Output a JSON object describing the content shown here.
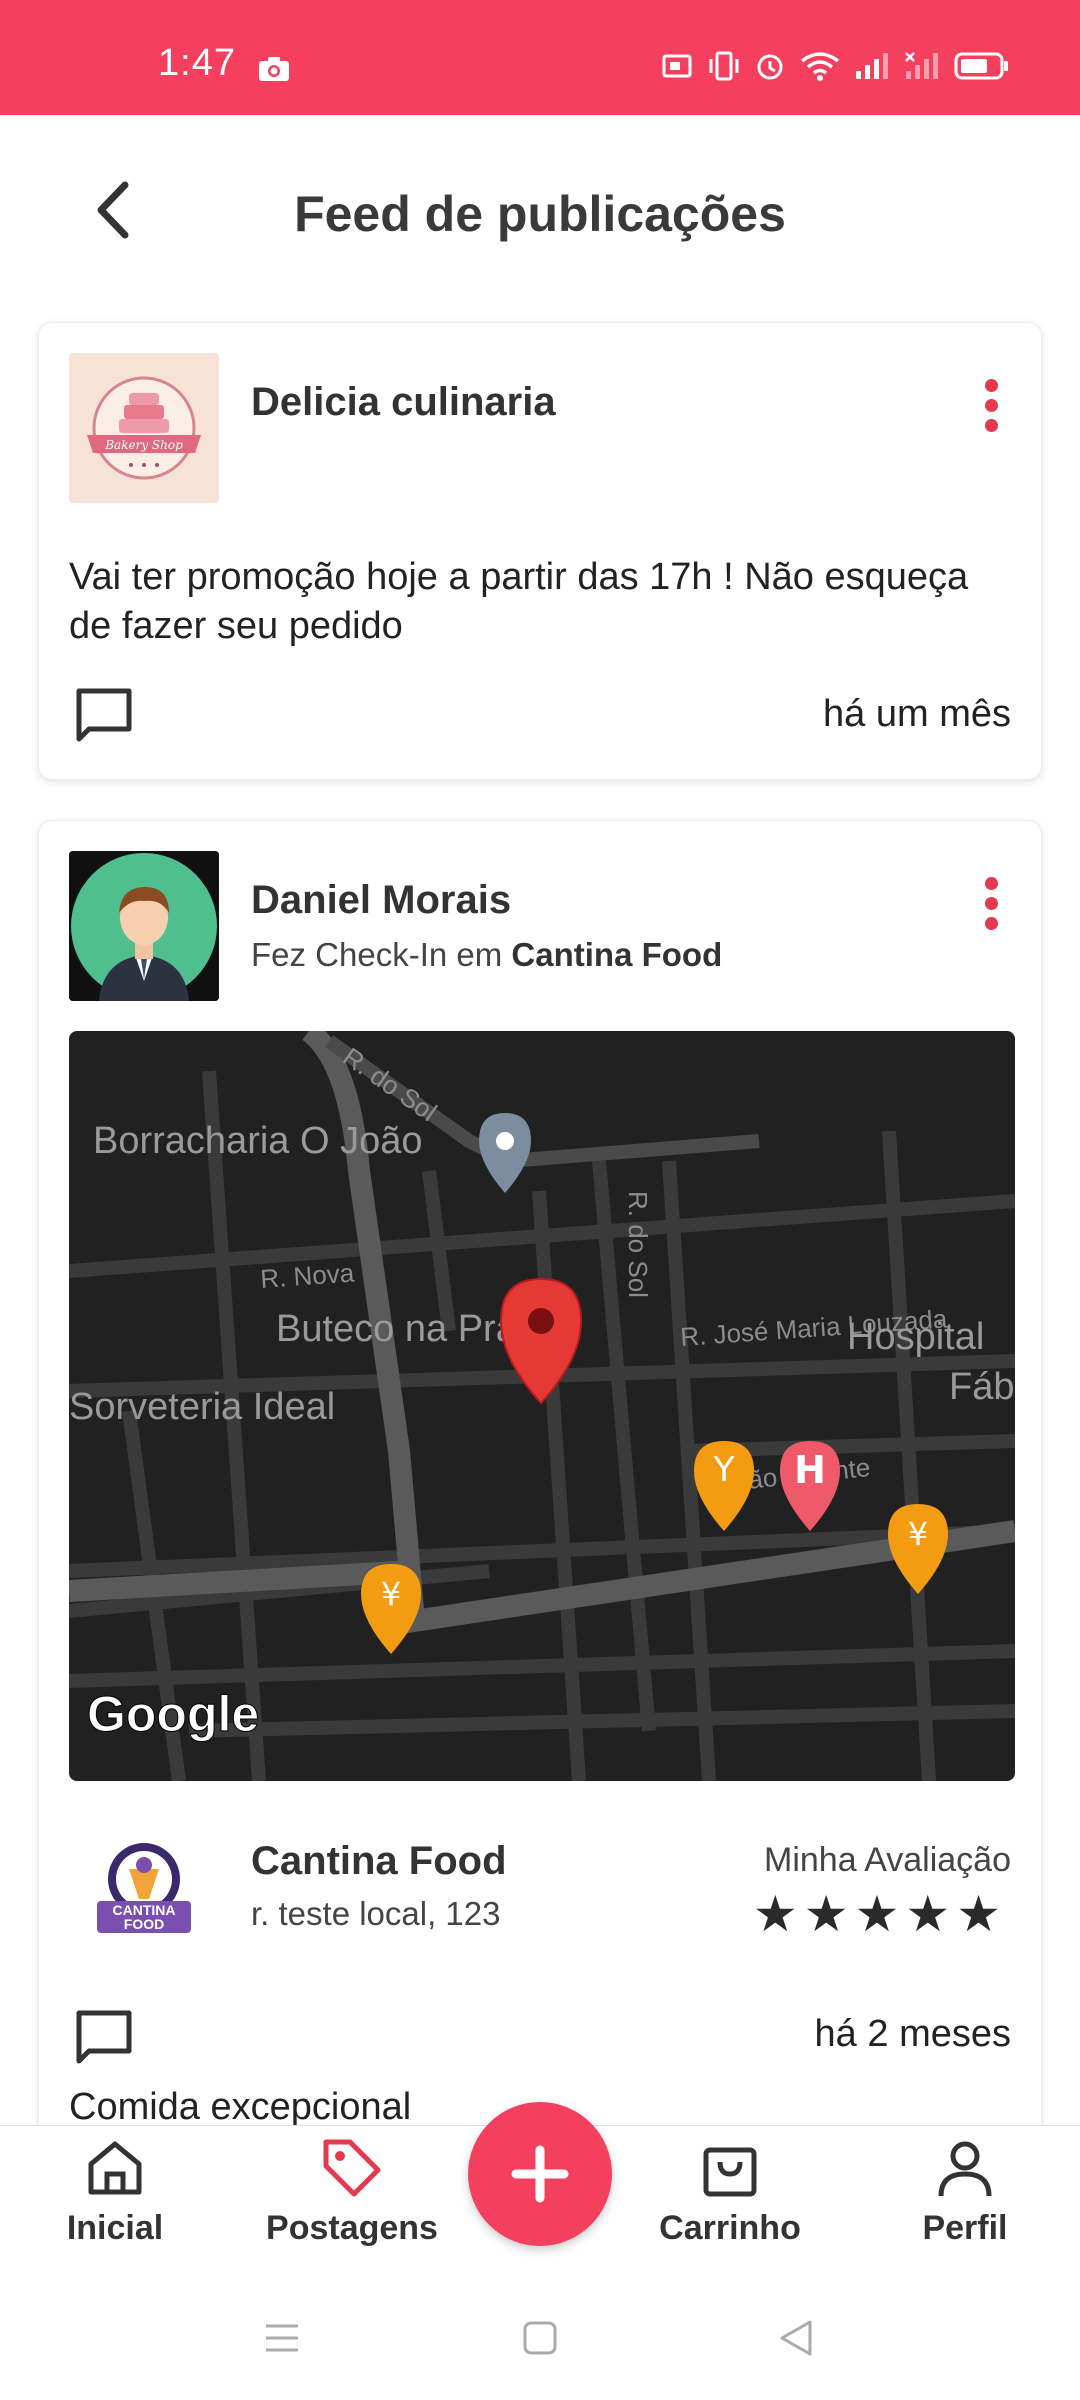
{
  "status_bar": {
    "time": "1:47"
  },
  "header": {
    "title": "Feed de publicações"
  },
  "posts": [
    {
      "author": "Delicia culinaria",
      "avatar_label": "Bakery Shop",
      "text": "Vai ter promoção hoje a partir das 17h ! Não esqueça de fazer seu pedido",
      "time_ago": "há um mês"
    },
    {
      "author": "Daniel Morais",
      "subtitle_prefix": "Fez Check-In em",
      "subtitle_place": "Cantina Food",
      "map": {
        "labels": {
          "r_do_sol_1": "R. do Sol",
          "r_do_sol_2": "R. do Sol",
          "borracharia": "Borracharia O João",
          "r_nova": "R. Nova",
          "r_jose": "R. José Maria Louzada",
          "buteco": "Buteco na Praça",
          "hospital": "Hospital",
          "fab": "Fáb",
          "sorveteria": "Sorveteria Ideal",
          "r_sao_vicente": "R. São Vicente",
          "google": "Google"
        }
      },
      "place": {
        "name": "Cantina Food",
        "address": "r. teste local, 123",
        "rating_label": "Minha Avaliação",
        "stars": "★★★★★",
        "logo_text": "CANTINA FOOD"
      },
      "time_ago": "há 2 meses",
      "comment_preview": "Comida excepcional"
    }
  ],
  "bottom_nav": {
    "items": [
      {
        "label": "Inicial"
      },
      {
        "label": "Postagens"
      },
      {
        "label": "Carrinho"
      },
      {
        "label": "Perfil"
      }
    ]
  },
  "colors": {
    "accent": "#f43f5e",
    "map_bg": "#212121"
  }
}
